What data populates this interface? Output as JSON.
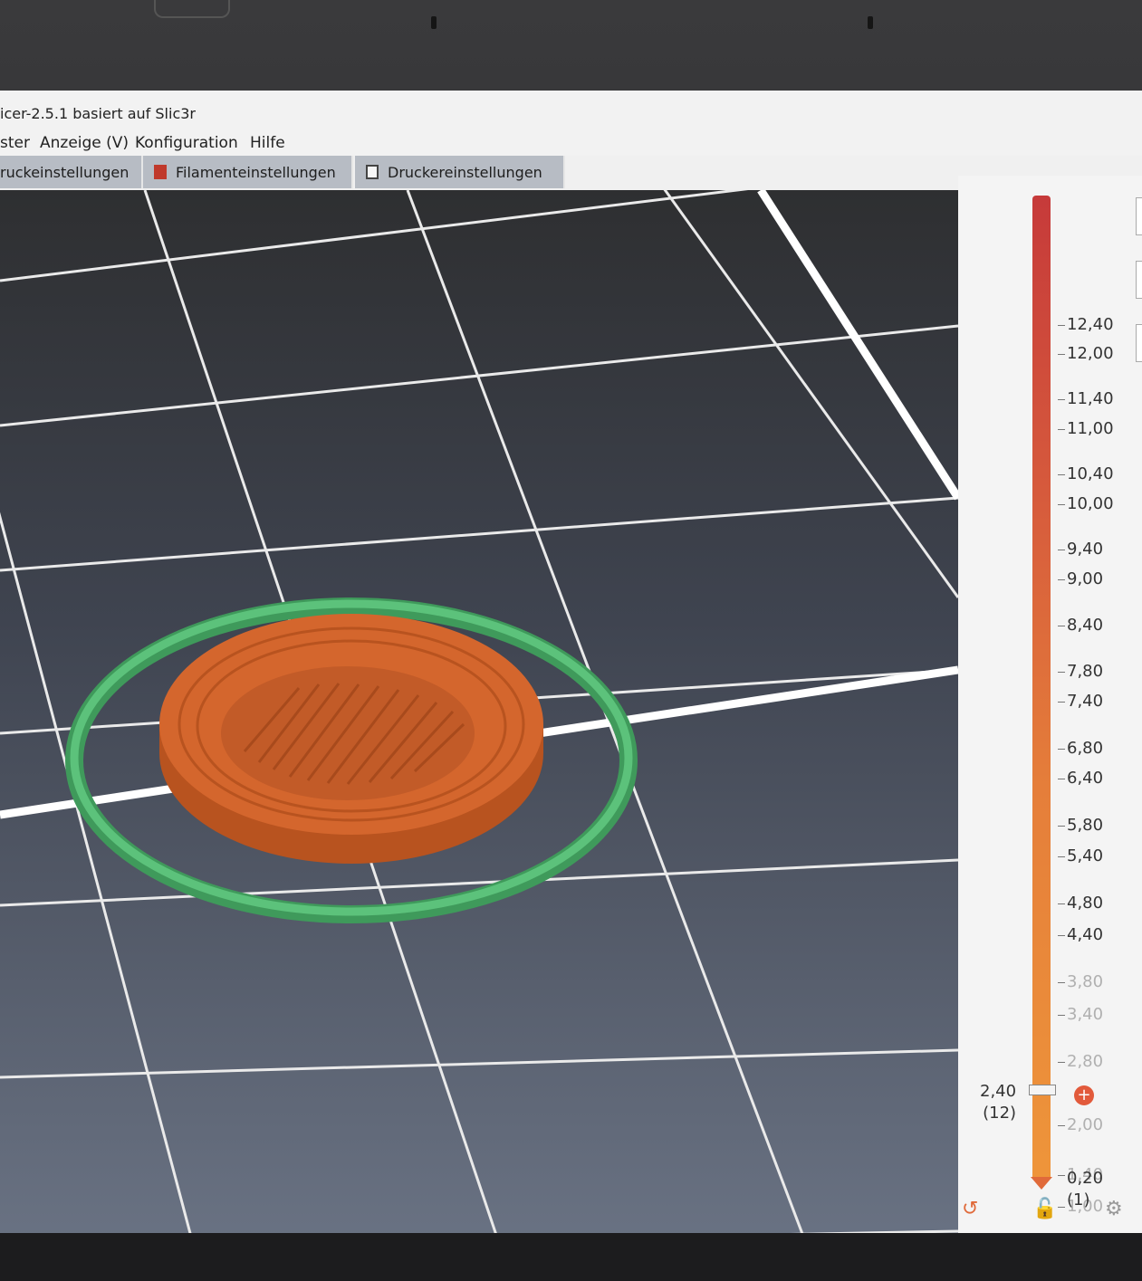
{
  "window": {
    "title": "icer-2.5.1 basiert auf Slic3r"
  },
  "menu": [
    {
      "label": "ster"
    },
    {
      "label": "Anzeige (V)"
    },
    {
      "label": "Konfiguration"
    },
    {
      "label": "Hilfe"
    }
  ],
  "tabs": [
    {
      "label": "ruckeinstellungen",
      "icon": "gear-icon"
    },
    {
      "label": "Filamenteinstellungen",
      "icon": "filament-icon",
      "icon_color": "#c0392b"
    },
    {
      "label": "Druckereinstellungen",
      "icon": "printer-icon"
    }
  ],
  "slider": {
    "ticks": [
      "12,40",
      "12,00",
      "11,40",
      "11,00",
      "10,40",
      "10,00",
      "9,40",
      "9,00",
      "8,40",
      "7,80",
      "7,40",
      "6,80",
      "6,40",
      "5,80",
      "5,40",
      "4,80",
      "4,40",
      "3,80",
      "3,40",
      "2,80",
      "2,00",
      "1,40",
      "1,00",
      "0,20"
    ],
    "dim_from_index": 17,
    "upper_handle": {
      "value": "2,40",
      "layer": "(12)"
    },
    "lower_handle": {
      "value": "0,20",
      "layer": "(1)"
    }
  },
  "colors": {
    "object": "#d4662d",
    "skirt": "#4fb36c",
    "bed": "#4a5060",
    "accent": "#e25a3b"
  },
  "icons": {
    "undo": "undo-icon",
    "lock": "lock-icon",
    "settings": "gear-icon"
  }
}
